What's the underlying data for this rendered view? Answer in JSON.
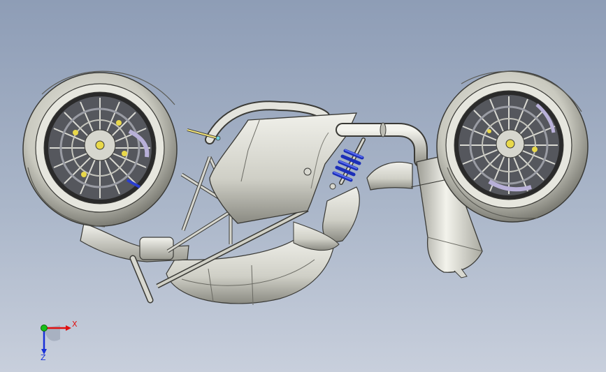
{
  "viewport": {
    "background_top": "#8e9db6",
    "background_bottom": "#c8cfdc"
  },
  "model": {
    "metal_light": "#e8e8e2",
    "metal_mid": "#bfbfb5",
    "metal_dark": "#6f6f68",
    "spring_color": "#2a3fd0",
    "highlight_yellow": "#e8d84a"
  },
  "triad": {
    "x_label": "X",
    "z_label": "Z",
    "x_color": "#e01010",
    "y_color": "#18c018",
    "z_color": "#1830d8"
  }
}
